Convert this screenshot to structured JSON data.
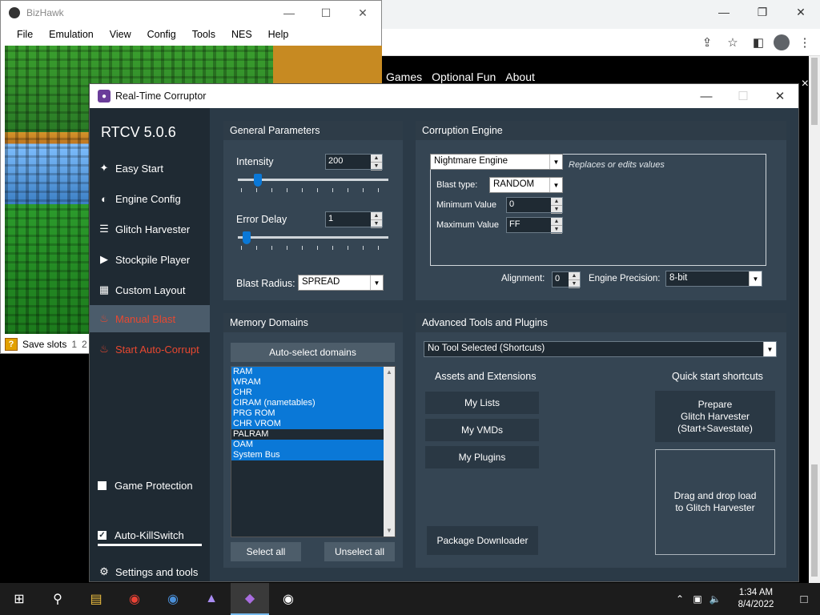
{
  "browser": {
    "nav_links": [
      "Games",
      "Optional Fun",
      "About"
    ],
    "close_symbol": "×"
  },
  "bizhawk": {
    "title": "BizHawk",
    "menu": [
      "File",
      "Emulation",
      "View",
      "Config",
      "Tools",
      "NES",
      "Help"
    ],
    "status": {
      "save_slots_label": "Save slots",
      "slot1": "1",
      "slot2": "2"
    }
  },
  "rtcv": {
    "title": "Real-Time Corruptor",
    "version": "RTCV 5.0.6",
    "sidebar": {
      "items": [
        {
          "label": "Easy Start",
          "icon": "wand-icon"
        },
        {
          "label": "Engine Config",
          "icon": "gauge-icon"
        },
        {
          "label": "Glitch Harvester",
          "icon": "layers-icon"
        },
        {
          "label": "Stockpile Player",
          "icon": "play-icon"
        },
        {
          "label": "Custom Layout",
          "icon": "grid-icon"
        },
        {
          "label": "Manual Blast",
          "icon": "fire-icon"
        },
        {
          "label": "Start Auto-Corrupt",
          "icon": "fire-icon"
        }
      ],
      "game_protection": "Game Protection",
      "auto_killswitch": "Auto-KillSwitch",
      "settings": "Settings and tools"
    },
    "general": {
      "title": "General Parameters",
      "intensity_label": "Intensity",
      "intensity_value": "200",
      "intensity_fraction": 0.08,
      "error_delay_label": "Error Delay",
      "error_delay_value": "1",
      "error_delay_fraction": 0.0,
      "blast_radius_label": "Blast Radius:",
      "blast_radius_value": "SPREAD"
    },
    "engine": {
      "title": "Corruption Engine",
      "engine_value": "Nightmare Engine",
      "engine_hint": "Replaces or edits values",
      "blast_type_label": "Blast type:",
      "blast_type_value": "RANDOM",
      "min_label": "Minimum Value",
      "min_value": "0",
      "max_label": "Maximum Value",
      "max_value": "FF",
      "alignment_label": "Alignment:",
      "alignment_value": "0",
      "precision_label": "Engine Precision:",
      "precision_value": "8-bit"
    },
    "memory": {
      "title": "Memory Domains",
      "auto_select": "Auto-select domains",
      "domains": [
        {
          "name": "RAM",
          "selected": true
        },
        {
          "name": "WRAM",
          "selected": true
        },
        {
          "name": "CHR",
          "selected": true
        },
        {
          "name": "CIRAM (nametables)",
          "selected": true
        },
        {
          "name": "PRG ROM",
          "selected": true
        },
        {
          "name": "CHR VROM",
          "selected": true
        },
        {
          "name": "PALRAM",
          "selected": false
        },
        {
          "name": "OAM",
          "selected": true
        },
        {
          "name": "System Bus",
          "selected": true
        }
      ],
      "select_all": "Select all",
      "unselect_all": "Unselect all"
    },
    "advanced": {
      "title": "Advanced Tools and Plugins",
      "tool_value": "No Tool Selected (Shortcuts)",
      "assets_title": "Assets and Extensions",
      "my_lists": "My Lists",
      "my_vmds": "My VMDs",
      "my_plugins": "My Plugins",
      "package_downloader": "Package Downloader",
      "quick_title": "Quick start shortcuts",
      "prepare_line1": "Prepare",
      "prepare_line2": "Glitch Harvester",
      "prepare_line3": "(Start+Savestate)",
      "drop_line1": "Drag and drop load",
      "drop_line2": "to Glitch Harvester"
    }
  },
  "taskbar": {
    "time": "1:34 AM",
    "date": "8/4/2022"
  }
}
